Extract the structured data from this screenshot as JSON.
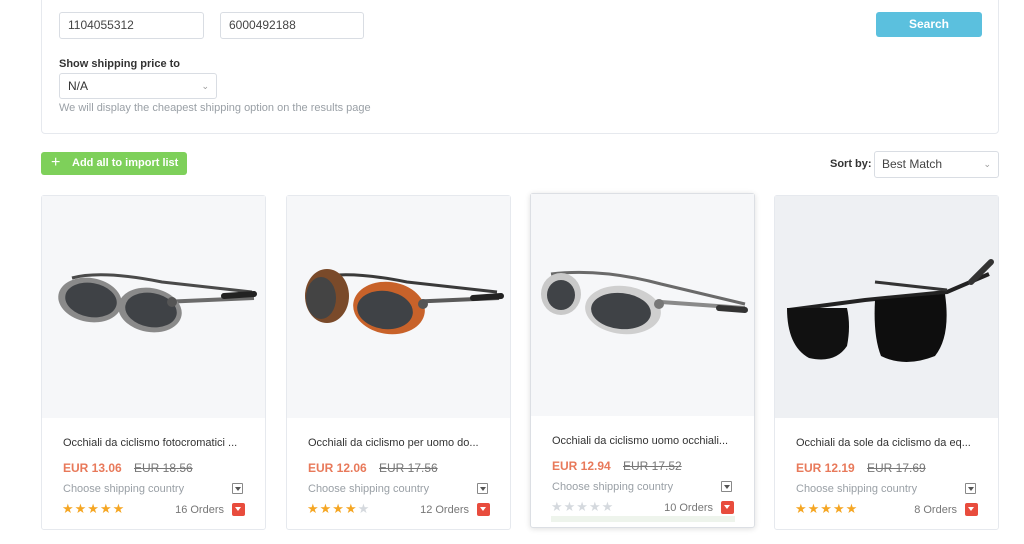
{
  "search": {
    "field1_value": "1104055312",
    "field2_value": "6000492188",
    "button_label": "Search"
  },
  "shipping": {
    "label": "Show shipping price to",
    "selected": "N/A",
    "hint": "We will display the cheapest shipping option on the results page"
  },
  "toolbar": {
    "add_all_label": "Add all to import list",
    "sort_label": "Sort by:",
    "sort_selected": "Best Match"
  },
  "colors": {
    "search_button": "#5bc0de",
    "add_button": "#7ed05a",
    "price": "#e8795a",
    "star": "#f5a623",
    "order_icon": "#e84c3d"
  },
  "products": [
    {
      "title": "Occhiali da ciclismo fotocromatici ...",
      "price": "EUR 13.06",
      "old_price": "EUR 18.56",
      "shipping": "Choose shipping country",
      "rating": 5,
      "orders": "16 Orders"
    },
    {
      "title": "Occhiali da ciclismo per uomo do...",
      "price": "EUR 12.06",
      "old_price": "EUR 17.56",
      "shipping": "Choose shipping country",
      "rating": 4,
      "orders": "12 Orders"
    },
    {
      "title": "Occhiali da ciclismo uomo occhiali...",
      "price": "EUR 12.94",
      "old_price": "EUR 17.52",
      "shipping": "Choose shipping country",
      "rating": 0,
      "orders": "10 Orders"
    },
    {
      "title": "Occhiali da sole da ciclismo da eq...",
      "price": "EUR 12.19",
      "old_price": "EUR 17.69",
      "shipping": "Choose shipping country",
      "rating": 5,
      "orders": "8 Orders"
    }
  ]
}
